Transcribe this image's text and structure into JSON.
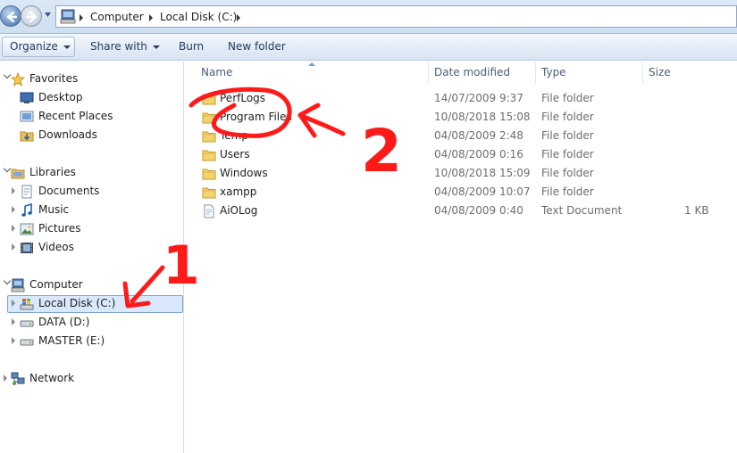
{
  "address_bar": {
    "breadcrumbs": [
      "Computer",
      "Local Disk (C:)"
    ]
  },
  "toolbar": {
    "organize": "Organize",
    "share_with": "Share with",
    "burn": "Burn",
    "new_folder": "New folder"
  },
  "nav": {
    "favorites": "Favorites",
    "desktop": "Desktop",
    "recent_places": "Recent Places",
    "downloads": "Downloads",
    "libraries": "Libraries",
    "documents": "Documents",
    "music": "Music",
    "pictures": "Pictures",
    "videos": "Videos",
    "computer": "Computer",
    "local_disk": "Local Disk (C:)",
    "data_drive": "DATA (D:)",
    "master_drive": "MASTER (E:)",
    "network": "Network",
    "selected": "Local Disk (C:)"
  },
  "columns": {
    "name": "Name",
    "date_modified": "Date modified",
    "type": "Type",
    "size": "Size"
  },
  "files": [
    {
      "name": "PerfLogs",
      "date": "14/07/2009 9:37",
      "type": "File folder",
      "size": "",
      "icon": "folder-icon"
    },
    {
      "name": "Program Files",
      "date": "10/08/2018 15:08",
      "type": "File folder",
      "size": "",
      "icon": "folder-icon"
    },
    {
      "name": "Temp",
      "date": "04/08/2009 2:48",
      "type": "File folder",
      "size": "",
      "icon": "folder-icon"
    },
    {
      "name": "Users",
      "date": "04/08/2009 0:16",
      "type": "File folder",
      "size": "",
      "icon": "folder-icon"
    },
    {
      "name": "Windows",
      "date": "10/08/2018 15:09",
      "type": "File folder",
      "size": "",
      "icon": "folder-icon"
    },
    {
      "name": "xampp",
      "date": "04/08/2009 10:07",
      "type": "File folder",
      "size": "",
      "icon": "folder-icon"
    },
    {
      "name": "AiOLog",
      "date": "04/08/2009 0:40",
      "type": "Text Document",
      "size": "1 KB",
      "icon": "text-document-icon"
    }
  ],
  "annotations": {
    "step_one": "1",
    "step_two": "2",
    "color": "#ff1a1a"
  },
  "colors": {
    "selection_fill": "#d9e8fb",
    "selection_border": "#7da2ce",
    "toolbar_text": "#1e3a5f",
    "column_header_text": "#4c607a",
    "meta_text": "#6d6d6d"
  }
}
